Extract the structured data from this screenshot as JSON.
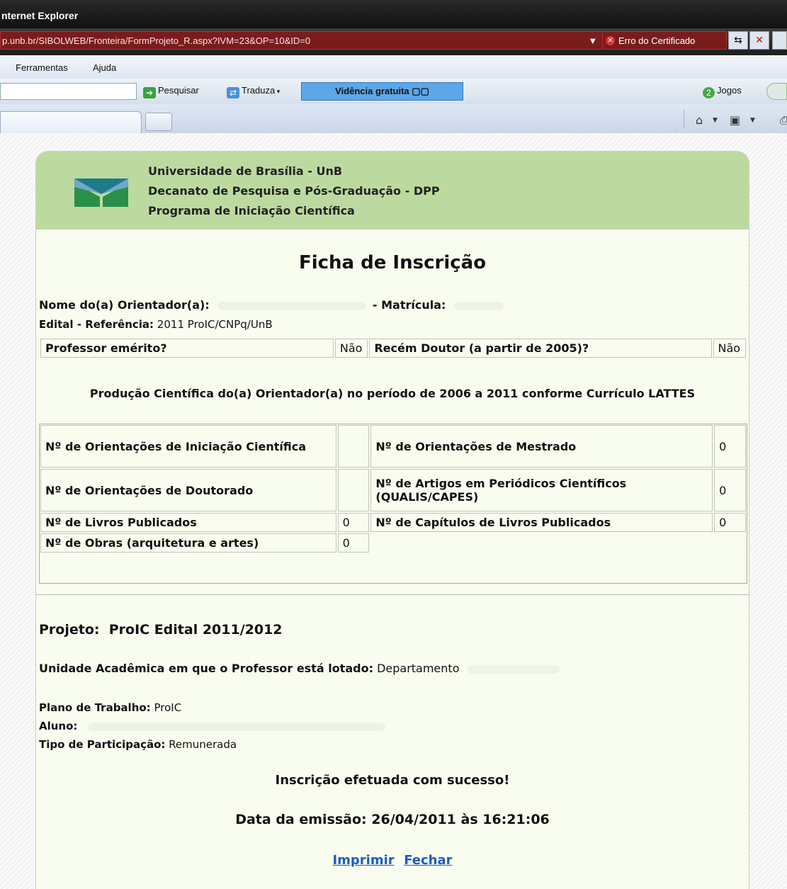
{
  "browser": {
    "title": "nternet Explorer",
    "url": "p.unb.br/SIBOLWEB/Fronteira/FormProjeto_R.aspx?IVM=23&OP=10&ID=0",
    "cert_error": "Erro do Certificado",
    "menu": [
      "Ferramentas",
      "Ajuda"
    ],
    "toolbar": {
      "search": "Pesquisar",
      "translate": "Traduza",
      "video": "Vidência gratuita",
      "games": "Jogos"
    }
  },
  "header": {
    "line1": "Universidade de Brasília - UnB",
    "line2": "Decanato de Pesquisa e Pós-Graduação - DPP",
    "line3": "Programa de Iniciação Científica"
  },
  "form": {
    "title": "Ficha de Inscrição",
    "orientador_label": "Nome do(a) Orientador(a):",
    "matricula_label": "- Matrícula:",
    "edital_label": "Edital - Referência:",
    "edital_value": "2011 ProIC/CNPq/UnB",
    "emerito_label": "Professor emérito?",
    "emerito_value": "Não",
    "recem_label": "Recém Doutor (a partir de 2005)?",
    "recem_value": "Não",
    "producao_title": "Produção Científica do(a) Orientador(a) no período de 2006 a 2011 conforme Currículo LATTES",
    "prod": {
      "ic_label": "Nº de Orientações de Iniciação Científica",
      "ic_value": "",
      "mestrado_label": "Nº de Orientações de Mestrado",
      "mestrado_value": "0",
      "doutorado_label": "Nº de Orientações de Doutorado",
      "doutorado_value": "",
      "artigos_label": "Nº de Artigos em Periódicos Científicos (QUALIS/CAPES)",
      "artigos_value": "0",
      "livros_label": "Nº de Livros Publicados",
      "livros_value": "0",
      "capitulos_label": "Nº de Capítulos de Livros Publicados",
      "capitulos_value": "0",
      "obras_label": "Nº de Obras (arquitetura e artes)",
      "obras_value": "0"
    },
    "projeto_label": "Projeto:",
    "projeto_value": "ProIC Edital 2011/2012",
    "unidade_label": "Unidade Acadêmica em que o Professor está lotado:",
    "unidade_value": "Departamento",
    "plano_label": "Plano de Trabalho:",
    "plano_value": "ProIC",
    "aluno_label": "Aluno:",
    "tipo_label": "Tipo de Participação:",
    "tipo_value": "Remunerada",
    "sucesso": "Inscrição efetuada com sucesso!",
    "emissao": "Data da emissão: 26/04/2011 às 16:21:06",
    "imprimir": "Imprimir",
    "fechar": "Fechar"
  }
}
